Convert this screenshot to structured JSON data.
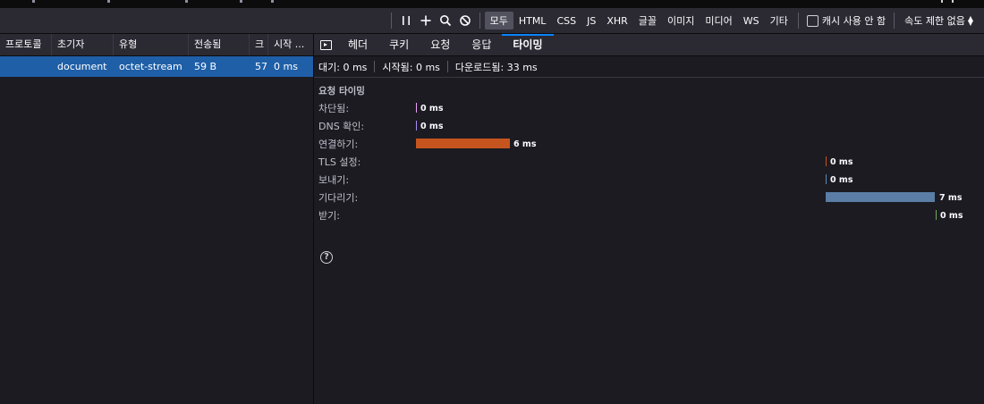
{
  "toolbar": {
    "filters": [
      "모두",
      "HTML",
      "CSS",
      "JS",
      "XHR",
      "글꼴",
      "이미지",
      "미디어",
      "WS",
      "기타"
    ],
    "active_filter": "모두",
    "cache_label": "캐시 사용 안 함",
    "throttle_label": "속도 제한 없음"
  },
  "columns": [
    "프로토콜",
    "초기자",
    "유형",
    "전송됨",
    "크",
    "시작 ..."
  ],
  "request": {
    "protocol": "",
    "initiator": "document",
    "type": "octet-stream",
    "transferred": "59 B",
    "size": "57",
    "start": "0 ms"
  },
  "tabs": [
    "헤더",
    "쿠키",
    "요청",
    "응답",
    "타이밍"
  ],
  "selected_tab": "타이밍",
  "summary": {
    "queued": "대기: 0 ms",
    "started": "시작됨: 0 ms",
    "downloaded": "다운로드됨: 33 ms"
  },
  "timing": {
    "section_title": "요청 타이밍",
    "rows": [
      {
        "label": "차단됨:",
        "value": "0 ms",
        "color": "#e9a2f6"
      },
      {
        "label": "DNS 확인:",
        "value": "0 ms",
        "color": "#a58cf5"
      },
      {
        "label": "연결하기:",
        "value": "6 ms",
        "color": "#c6541f"
      },
      {
        "label": "TLS 설정:",
        "value": "0 ms",
        "color": "#c6541f"
      },
      {
        "label": "보내기:",
        "value": "0 ms",
        "color": "#5b8ab8"
      },
      {
        "label": "기다리기:",
        "value": "7 ms",
        "color": "#5a7ea5"
      },
      {
        "label": "받기:",
        "value": "0 ms",
        "color": "#6bab5a"
      }
    ]
  },
  "icons": {
    "pause": "pause-icon",
    "add": "plus-icon",
    "search": "search-icon",
    "block": "block-icon",
    "help": "help-icon"
  }
}
